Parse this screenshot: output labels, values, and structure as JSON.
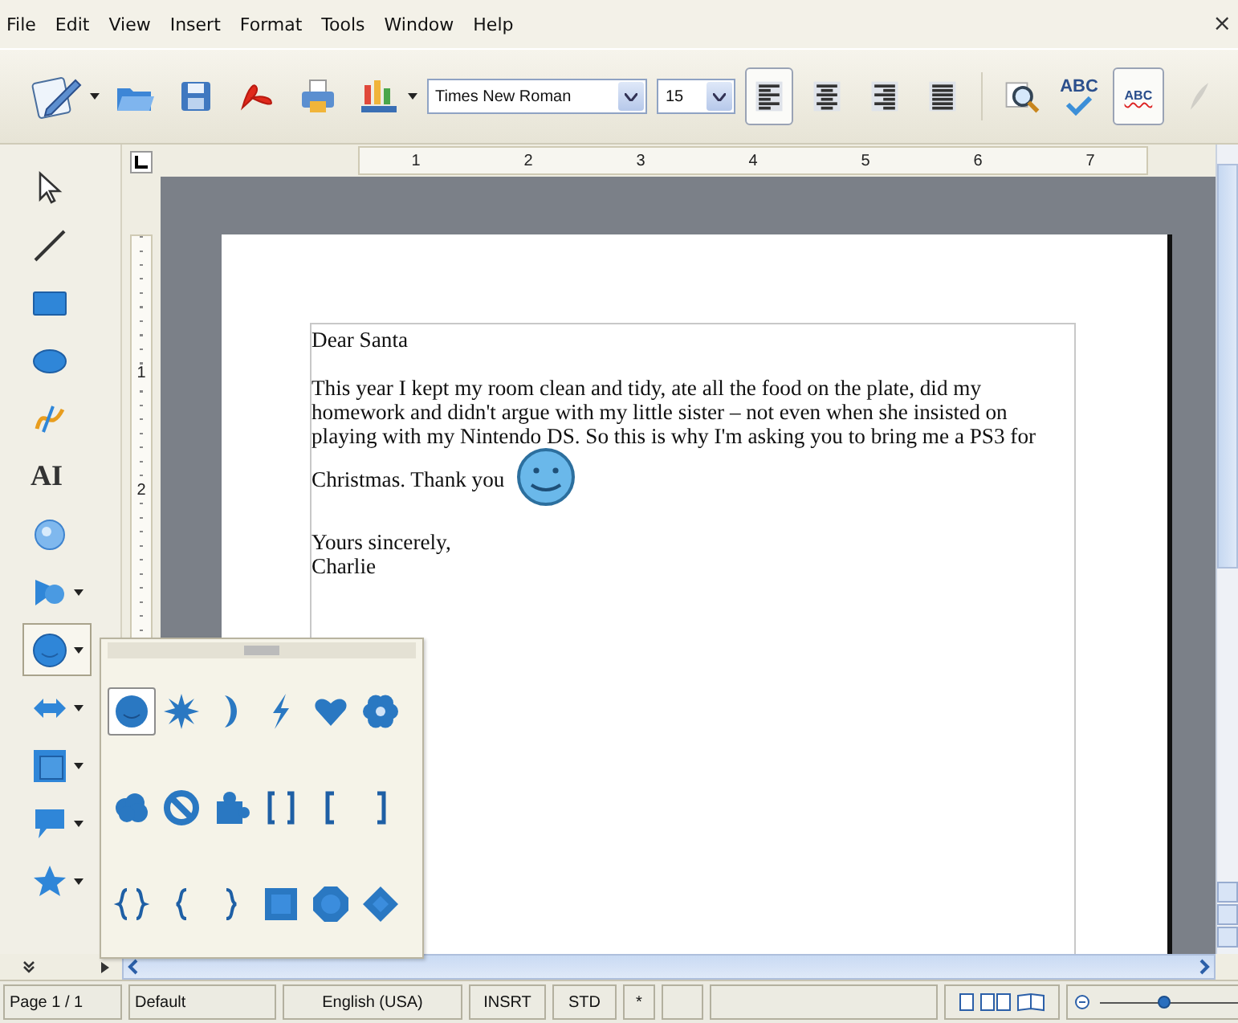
{
  "menu": [
    "File",
    "Edit",
    "View",
    "Insert",
    "Format",
    "Tools",
    "Window",
    "Help"
  ],
  "close_glyph": "×",
  "toolbar": {
    "file_buttons": [
      {
        "kind": "edit-file",
        "dropdown": true
      },
      {
        "kind": "open",
        "dropdown": false
      },
      {
        "kind": "save",
        "dropdown": false
      },
      {
        "kind": "pdf",
        "dropdown": false
      },
      {
        "kind": "print",
        "dropdown": false
      },
      {
        "kind": "chart",
        "dropdown": true
      }
    ],
    "font_name": "Times New Roman",
    "font_size": "15",
    "align": [
      {
        "kind": "left",
        "selected": true
      },
      {
        "kind": "center",
        "selected": false
      },
      {
        "kind": "right",
        "selected": false
      },
      {
        "kind": "justify",
        "selected": false
      }
    ],
    "tools": [
      {
        "kind": "find",
        "selected": false,
        "disabled": false
      },
      {
        "kind": "spelling",
        "label": "ABC",
        "selected": false,
        "disabled": false
      },
      {
        "kind": "autospell",
        "label": "ABC",
        "selected": true,
        "disabled": false
      },
      {
        "kind": "clone",
        "selected": false,
        "disabled": true
      }
    ]
  },
  "drawing_toolbar": [
    {
      "kind": "select",
      "dropdown": false,
      "selected": false
    },
    {
      "kind": "line",
      "dropdown": false,
      "selected": false
    },
    {
      "kind": "rectangle",
      "dropdown": false,
      "selected": false
    },
    {
      "kind": "ellipse",
      "dropdown": false,
      "selected": false
    },
    {
      "kind": "curve",
      "dropdown": false,
      "selected": false
    },
    {
      "kind": "fontwork",
      "label": "AI",
      "dropdown": false,
      "selected": false
    },
    {
      "kind": "gallery",
      "dropdown": false,
      "selected": false
    },
    {
      "kind": "basic-shapes",
      "dropdown": true,
      "selected": false
    },
    {
      "kind": "symbol-shapes",
      "dropdown": true,
      "selected": true
    },
    {
      "kind": "block-arrows",
      "dropdown": true,
      "selected": false
    },
    {
      "kind": "flowchart",
      "dropdown": true,
      "selected": false
    },
    {
      "kind": "callout",
      "dropdown": true,
      "selected": false
    },
    {
      "kind": "star",
      "dropdown": true,
      "selected": false
    }
  ],
  "symbol_palette": [
    {
      "kind": "smiley",
      "selected": true
    },
    {
      "kind": "sun",
      "selected": false
    },
    {
      "kind": "moon",
      "selected": false
    },
    {
      "kind": "lightning",
      "selected": false
    },
    {
      "kind": "heart",
      "selected": false
    },
    {
      "kind": "flower",
      "selected": false
    },
    {
      "kind": "cloud",
      "selected": false
    },
    {
      "kind": "forbidden",
      "selected": false
    },
    {
      "kind": "puzzle",
      "selected": false
    },
    {
      "kind": "bracket-pair",
      "selected": false
    },
    {
      "kind": "left-bracket",
      "selected": false
    },
    {
      "kind": "right-bracket",
      "selected": false
    },
    {
      "kind": "brace-pair",
      "selected": false
    },
    {
      "kind": "left-brace",
      "selected": false
    },
    {
      "kind": "right-brace",
      "selected": false
    },
    {
      "kind": "square-bevel",
      "selected": false
    },
    {
      "kind": "octagon-bevel",
      "selected": false
    },
    {
      "kind": "diamond-bevel",
      "selected": false
    }
  ],
  "ruler": {
    "horizontal": [
      "1",
      "2",
      "3",
      "4",
      "5",
      "6",
      "7"
    ],
    "vertical": [
      "1",
      "2"
    ]
  },
  "document": {
    "paragraphs": [
      {
        "kind": "text",
        "lines": [
          "Dear Santa"
        ]
      },
      {
        "lines": [
          "This year I kept my room clean and tidy, ate all the food on the plate, did my",
          "homework and didn't argue with my little sister – not even when she insisted on",
          "playing with my Nintendo DS. So this is why I'm asking you to bring me a PS3 for",
          "Christmas. Thank you"
        ],
        "kind": "smiley-end"
      },
      {
        "kind": "text",
        "lines": [
          "Yours sincerely,",
          "Charlie"
        ]
      }
    ]
  },
  "status_bar": {
    "cells": [
      "Page 1 / 1",
      "Default",
      "English (USA)",
      "INSRT",
      "STD",
      "*"
    ],
    "zoom": {
      "level": 0.45
    }
  }
}
